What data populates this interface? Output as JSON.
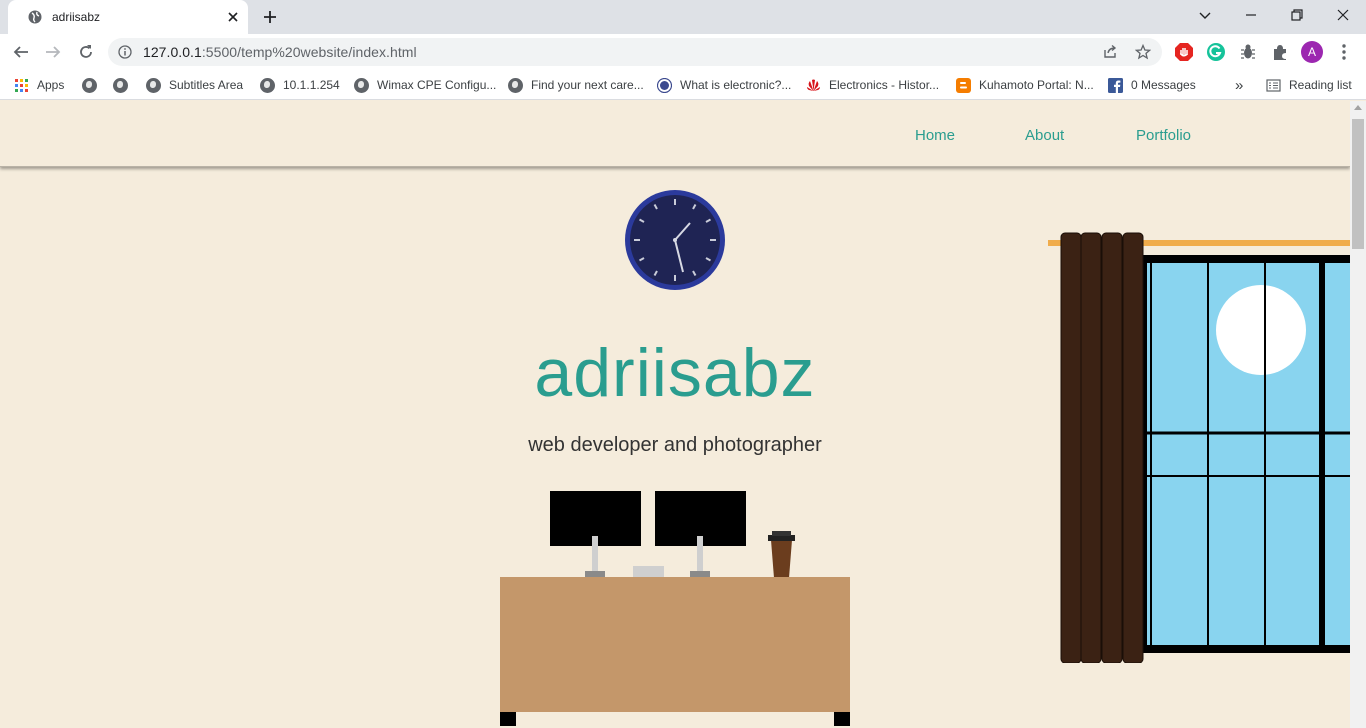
{
  "browser": {
    "tab_title": "adriisabz",
    "url_host": "127.0.0.1",
    "url_rest": ":5500/temp%20website/index.html",
    "profile_initial": "A",
    "bookmarks": [
      {
        "label": "Apps",
        "icon": "apps-grid-icon"
      },
      {
        "label": "",
        "icon": "globe-icon"
      },
      {
        "label": "",
        "icon": "globe-icon"
      },
      {
        "label": "Subtitles Area",
        "icon": "globe-icon"
      },
      {
        "label": "10.1.1.254",
        "icon": "globe-icon"
      },
      {
        "label": "Wimax CPE Configu...",
        "icon": "globe-icon"
      },
      {
        "label": "Find your next care...",
        "icon": "globe-icon"
      },
      {
        "label": "What is electronic?...",
        "icon": "bd-logo-icon"
      },
      {
        "label": "Electronics - Histor...",
        "icon": "huawei-icon"
      },
      {
        "label": "Kuhamoto Portal: N...",
        "icon": "blogger-icon"
      },
      {
        "label": "0 Messages",
        "icon": "facebook-icon"
      }
    ],
    "overflow_label": "»",
    "reading_list": "Reading list"
  },
  "site": {
    "nav": [
      {
        "label": "Home"
      },
      {
        "label": "About"
      },
      {
        "label": "Portfolio"
      }
    ],
    "title": "adriisabz",
    "subtitle": "web developer and photographer"
  },
  "colors": {
    "page_bg": "#f5ecdc",
    "accent": "#2a9d8f",
    "clock_face": "#1f2454",
    "clock_rim": "#2b3a9c",
    "desk": "#c4976a",
    "sky": "#89d4ef",
    "curtain": "#3b2214",
    "rod": "#f0ac4b"
  }
}
